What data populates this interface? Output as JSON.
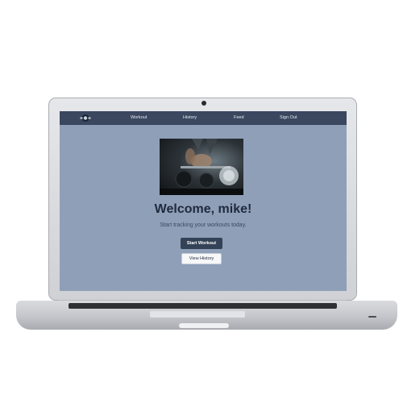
{
  "navbar": {
    "links": [
      "Workout",
      "History",
      "Feed",
      "Sign Out"
    ]
  },
  "hero": {
    "image": "workout-photo"
  },
  "welcome": {
    "title": "Welcome, mike!",
    "subtitle": "Start tracking your workouts today."
  },
  "actions": {
    "start_label": "Start Workout",
    "history_label": "View History"
  },
  "colors": {
    "navbar": "#3a475f",
    "background": "#8f9fb8",
    "primary_button": "#344257",
    "heading": "#1f2a3d"
  }
}
